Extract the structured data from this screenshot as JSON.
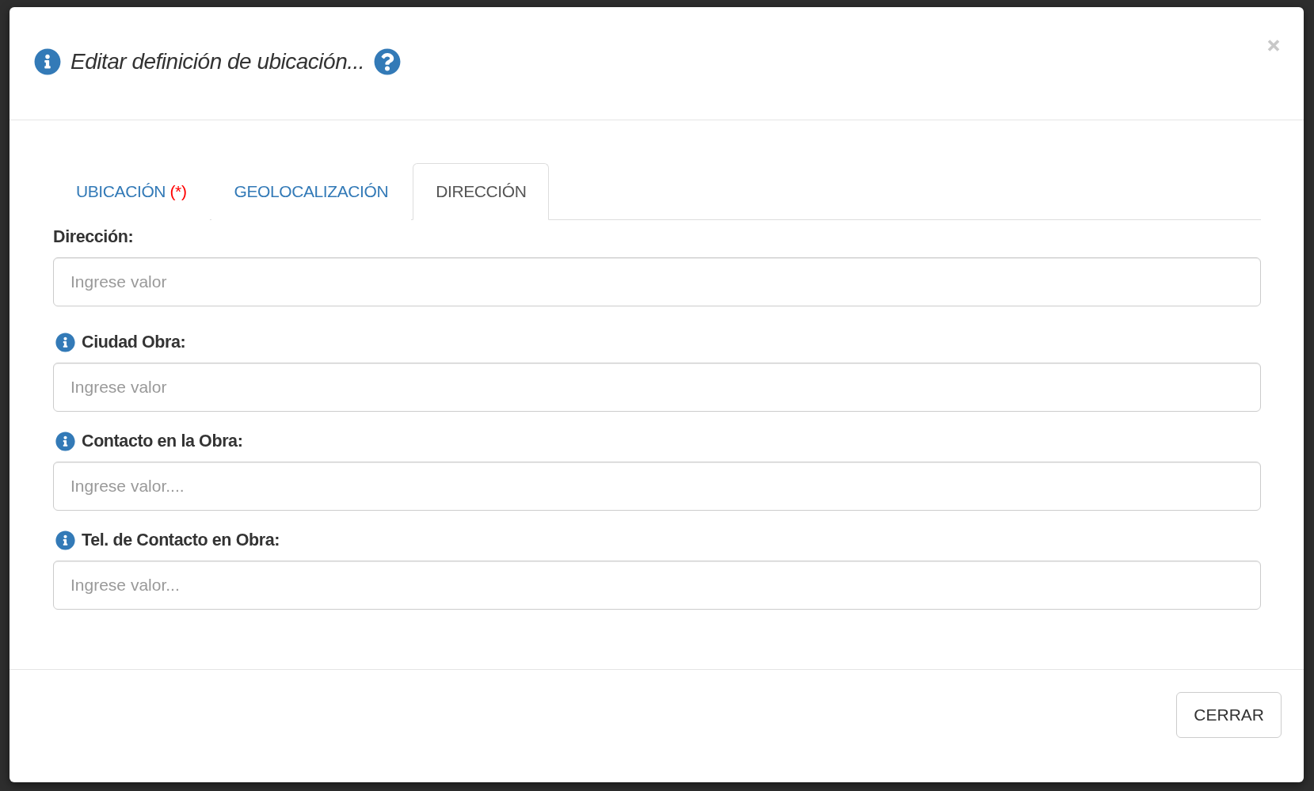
{
  "dialog": {
    "title": "Editar definición de ubicación...",
    "tabs": [
      {
        "label": "UBICACIÓN",
        "marker": "(*)",
        "selected": false
      },
      {
        "label": "GEOLOCALIZACIÓN",
        "selected": false
      },
      {
        "label": "DIRECCIÓN",
        "selected": true
      }
    ],
    "fields": [
      {
        "label": "Dirección:",
        "info": false,
        "placeholder": "Ingrese valor"
      },
      {
        "label": "Ciudad Obra:",
        "info": true,
        "placeholder": "Ingrese valor"
      },
      {
        "label": "Contacto en la Obra:",
        "info": true,
        "placeholder": "Ingrese valor...."
      },
      {
        "label": "Tel. de Contacto en Obra:",
        "info": true,
        "placeholder": "Ingrese valor..."
      }
    ],
    "buttons": [
      {
        "label": "CERRAR"
      }
    ]
  }
}
